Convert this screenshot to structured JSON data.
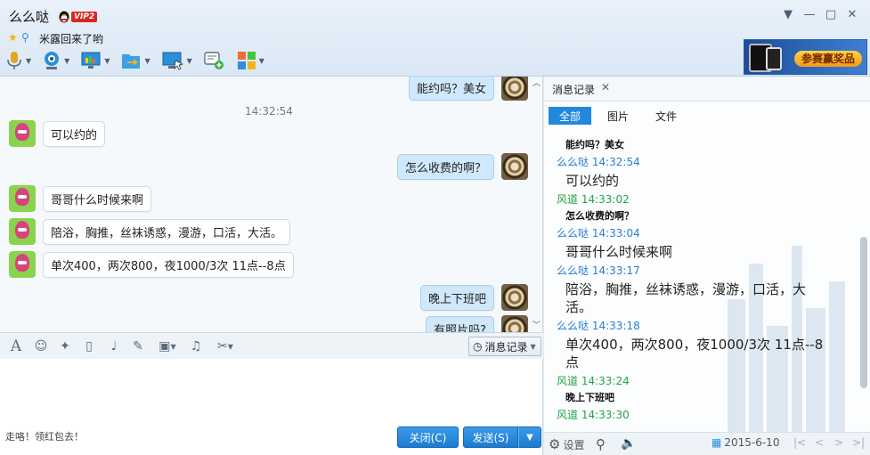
{
  "header": {
    "contact_name": "么么哒",
    "vip_badge": "VIP2",
    "signature": "米露回来了哟",
    "window_controls": [
      "chevron-down-icon",
      "minimize-icon",
      "maximize-icon",
      "close-icon"
    ]
  },
  "toolbar": {
    "items": [
      "microphone-icon",
      "camera-icon",
      "screen-share-icon",
      "file-transfer-icon",
      "remote-desktop-icon",
      "add-chat-icon",
      "apps-icon"
    ]
  },
  "ad": {
    "text": "参赛赢奖品"
  },
  "chat": {
    "timestamp": "14:32:54",
    "messages": [
      {
        "side": "right",
        "text": "能约吗？美女"
      },
      {
        "side": "left",
        "text": "可以约的"
      },
      {
        "side": "right",
        "text": "怎么收费的啊？"
      },
      {
        "side": "left",
        "text": "哥哥什么时候来啊"
      },
      {
        "side": "left",
        "text": "陪浴，胸推，丝袜诱惑，漫游，口活，大活。"
      },
      {
        "side": "left",
        "text": "单次400，两次800，夜1000/3次 11点--8点"
      },
      {
        "side": "right",
        "text": "晚上下班吧"
      },
      {
        "side": "right",
        "text": "有照片吗?"
      }
    ]
  },
  "input_toolbar": {
    "icons": [
      "font-icon",
      "emoji-icon",
      "nudge-icon",
      "gif-icon",
      "voice-icon",
      "edit-icon",
      "image-icon",
      "music-icon",
      "screenshot-icon"
    ],
    "record_label": "消息记录"
  },
  "input": {
    "tip": "走咯！领红包去！",
    "close_label": "关闭(C)",
    "send_label": "发送(S)"
  },
  "history": {
    "tab_label": "消息记录",
    "filters": [
      "全部",
      "图片",
      "文件"
    ],
    "active_filter": "全部",
    "entries": [
      {
        "type": "small",
        "text": "能约吗？美女"
      },
      {
        "type": "head-other",
        "text": "么么哒 14:32:54"
      },
      {
        "type": "big",
        "text": "可以约的"
      },
      {
        "type": "head-self",
        "text": "风道 14:33:02"
      },
      {
        "type": "small",
        "text": "怎么收费的啊？"
      },
      {
        "type": "head-other",
        "text": "么么哒 14:33:04"
      },
      {
        "type": "big",
        "text": "哥哥什么时候来啊"
      },
      {
        "type": "head-other",
        "text": "么么哒 14:33:17"
      },
      {
        "type": "big",
        "text": "陪浴，胸推，丝袜诱惑，漫游，口活，大活。"
      },
      {
        "type": "head-other",
        "text": "么么哒 14:33:18"
      },
      {
        "type": "big",
        "text": "单次400，两次800，夜1000/3次 11点--8点"
      },
      {
        "type": "head-self",
        "text": "风道 14:33:24"
      },
      {
        "type": "small",
        "text": "晚上下班吧"
      },
      {
        "type": "head-self",
        "text": "风道 14:33:30"
      }
    ],
    "settings_label": "设置",
    "date": "2015-6-10"
  }
}
